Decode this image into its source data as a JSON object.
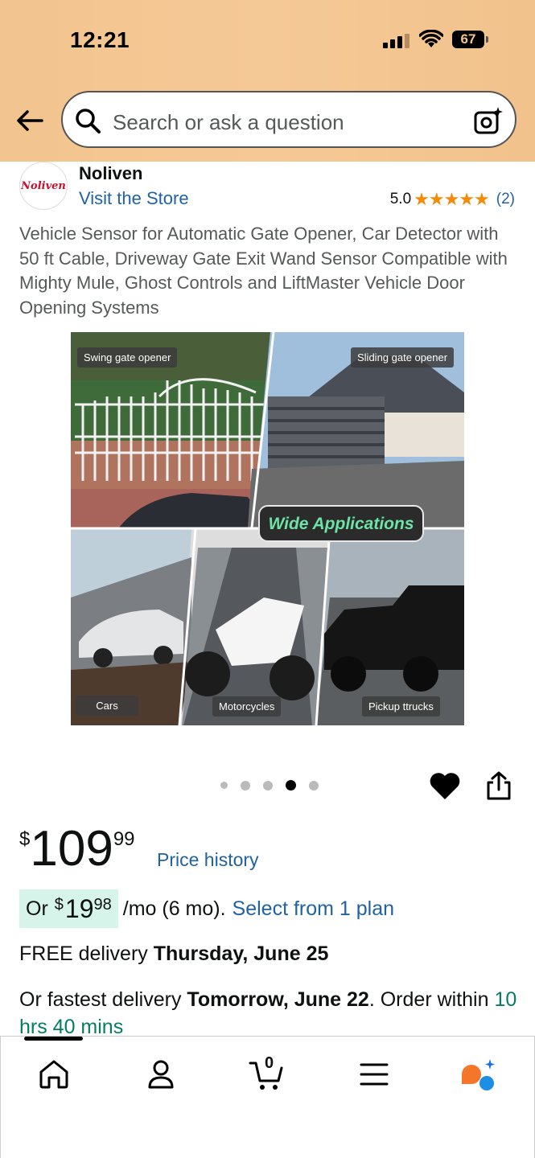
{
  "status_bar": {
    "time": "12:21",
    "battery": "67"
  },
  "search": {
    "placeholder": "Search or ask a question"
  },
  "store": {
    "logo_text": "Noliven",
    "name": "Noliven",
    "visit_label": "Visit the Store"
  },
  "rating": {
    "value": "5.0",
    "stars": "★★★★★",
    "count": "(2)"
  },
  "product": {
    "title": "Vehicle Sensor for Automatic Gate Opener, Car Detector with 50 ft Cable, Driveway Gate Exit Wand Sensor Compatible with Mighty Mule, Ghost Controls and LiftMaster Vehicle Door Opening Systems",
    "image_labels": {
      "swing": "Swing gate opener",
      "sliding": "Sliding gate opener",
      "wide": "Wide Applications",
      "cars": "Cars",
      "motorcycles": "Motorcycles",
      "pickup": "Pickup ttrucks"
    },
    "carousel": {
      "total": 5,
      "active_index": 4
    }
  },
  "price": {
    "symbol": "$",
    "whole": "109",
    "fraction": "99",
    "history_label": "Price history"
  },
  "monthly": {
    "prefix": "Or",
    "symbol": "$",
    "whole": "19",
    "fraction": "98",
    "suffix": "/mo (6 mo).",
    "link": "Select from 1 plan"
  },
  "delivery": {
    "free_prefix": "FREE delivery",
    "free_date": "Thursday, June 25",
    "fast_prefix": "Or fastest delivery",
    "fast_date": "Tomorrow, June 22",
    "fast_suffix": ". Order",
    "within": "within",
    "countdown": "10 hrs 40 mins"
  },
  "cart": {
    "count": "0"
  },
  "colors": {
    "accent_link": "#2162a1",
    "header_bg": "#f2c48f",
    "star": "#f28c08",
    "green": "#067d62"
  },
  "icons": [
    "back-arrow-icon",
    "search-icon",
    "camera-icon",
    "heart-icon",
    "share-icon",
    "home-icon",
    "account-icon",
    "cart-icon",
    "menu-icon",
    "rufus-icon"
  ]
}
